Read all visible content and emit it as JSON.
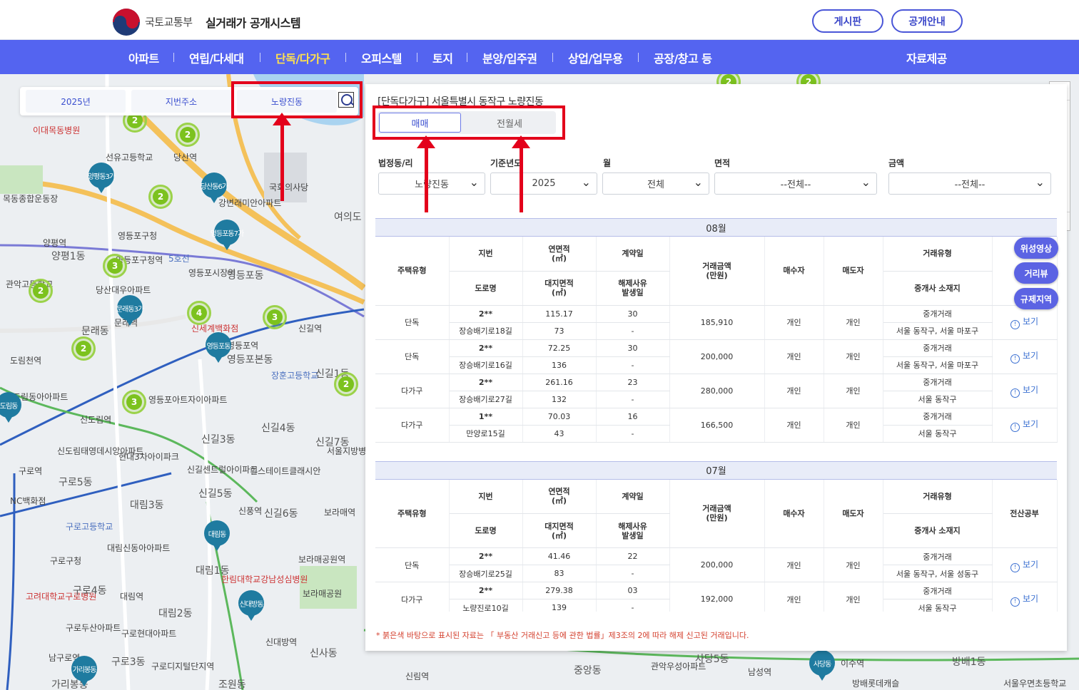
{
  "header": {
    "ministry": "국토교통부",
    "system_title": "실거래가 공개시스템",
    "board_label": "게시판",
    "info_label": "공개안내"
  },
  "nav": {
    "items": [
      {
        "label": "아파트",
        "active": false
      },
      {
        "label": "연립/다세대",
        "active": false
      },
      {
        "label": "단독/다가구",
        "active": true
      },
      {
        "label": "오피스텔",
        "active": false
      },
      {
        "label": "토지",
        "active": false
      },
      {
        "label": "분양/입주권",
        "active": false
      },
      {
        "label": "상업/업무용",
        "active": false
      },
      {
        "label": "공장/창고 등",
        "active": false
      }
    ],
    "data_label": "자료제공"
  },
  "search": {
    "year": "2025년",
    "address_type": "지번주소",
    "dong": "노량진동"
  },
  "panel": {
    "title": "[단독다가구] 서울특별시 동작구 노량진동",
    "tabs": [
      "매매",
      "전월세"
    ],
    "filters": {
      "labels": [
        "법정동/리",
        "기준년도",
        "월",
        "면적",
        "금액"
      ],
      "values": [
        "노량진동",
        "2025",
        "전체",
        "--전체--",
        "--전체--"
      ]
    },
    "headers": {
      "house_type": "주택유형",
      "jibun": "지번",
      "road": "도로명",
      "area": "연면적\n(㎡)",
      "land_area": "대지면적\n(㎡)",
      "contract_day": "계약일",
      "cancel": "해제사유\n발생일",
      "price": "거래금액\n(만원)",
      "buyer": "매수자",
      "seller": "매도자",
      "deal_type": "거래유형",
      "agent_loc": "중개사 소재지",
      "registry": "전산공부"
    },
    "months": [
      {
        "label": "08월",
        "rows": [
          {
            "type": "단독",
            "jibun": "2**",
            "road": "장승배기로18길",
            "area": "115.17",
            "land": "73",
            "day": "30",
            "cancel": "-",
            "price": "185,910",
            "buyer": "개인",
            "seller": "개인",
            "deal": "중개거래",
            "agent": "서울 동작구, 서울 마포구",
            "view": "보기"
          },
          {
            "type": "단독",
            "jibun": "2**",
            "road": "장승배기로16길",
            "area": "72.25",
            "land": "136",
            "day": "30",
            "cancel": "-",
            "price": "200,000",
            "buyer": "개인",
            "seller": "개인",
            "deal": "중개거래",
            "agent": "서울 동작구, 서울 마포구",
            "view": "보기"
          },
          {
            "type": "다가구",
            "jibun": "2**",
            "road": "장승배기로27길",
            "area": "261.16",
            "land": "132",
            "day": "23",
            "cancel": "-",
            "price": "280,000",
            "buyer": "개인",
            "seller": "개인",
            "deal": "중개거래",
            "agent": "서울 동작구",
            "view": "보기"
          },
          {
            "type": "다가구",
            "jibun": "1**",
            "road": "만양로15길",
            "area": "70.03",
            "land": "43",
            "day": "16",
            "cancel": "-",
            "price": "166,500",
            "buyer": "개인",
            "seller": "개인",
            "deal": "중개거래",
            "agent": "서울 동작구",
            "view": "보기"
          }
        ]
      },
      {
        "label": "07월",
        "rows": [
          {
            "type": "단독",
            "jibun": "2**",
            "road": "장승배기로25길",
            "area": "41.46",
            "land": "83",
            "day": "22",
            "cancel": "-",
            "price": "200,000",
            "buyer": "개인",
            "seller": "개인",
            "deal": "중개거래",
            "agent": "서울 동작구, 서울 성동구",
            "view": "보기"
          },
          {
            "type": "다가구",
            "jibun": "2**",
            "road": "노량진로10길",
            "area": "279.38",
            "land": "139",
            "day": "03",
            "cancel": "-",
            "price": "192,000",
            "buyer": "개인",
            "seller": "개인",
            "deal": "중개거래",
            "agent": "서울 동작구",
            "view": "보기"
          }
        ]
      }
    ],
    "note": "* 붉은색 바탕으로 표시된 자료는 「 부동산 거래신고 등에 관한 법률」제3조의 2에 따라 해제 신고된 거래입니다."
  },
  "side_buttons": [
    "위성영상",
    "거리뷰",
    "규제지역"
  ],
  "map": {
    "labels": [
      "이대목동병원",
      "선유고등학교",
      "당산역",
      "목동종합운동장",
      "강변래미안아파트",
      "국회의사당",
      "여의도",
      "양평역",
      "양평1동",
      "영등포구청",
      "영등포구청역",
      "5호선",
      "관악고등학교",
      "당산대우아파트",
      "영등포시장역",
      "영등포동",
      "문래동",
      "문래역",
      "신세계백화점",
      "영등포역",
      "영등포본동",
      "신길역",
      "장훈고등학교",
      "신길1동",
      "도림천역",
      "도림동아아파트",
      "영등포아트자이아파트",
      "신도림역",
      "신도림태영데시앙아파트",
      "현대3차아이파크",
      "신길3동",
      "신길4동",
      "신길7동",
      "서울지방병무청",
      "구로역",
      "구로5동",
      "신길센트럴아이파크",
      "힐스테이트클래시안",
      "신길5동",
      "NC백화점",
      "대림3동",
      "신풍역",
      "신길6동",
      "보라매역",
      "구로고등학교",
      "대림신동아아파트",
      "구로구청",
      "보라매공원역",
      "대림1동",
      "한림대학교강남성심병원",
      "고려대학교구로병원",
      "구로4동",
      "대림역",
      "보라매공원",
      "대림2동",
      "신대방역",
      "구로두산아파트",
      "구로현대아파트",
      "신사동",
      "남구로역",
      "구로3동",
      "구로디지털단지역",
      "신림역",
      "중앙동",
      "관악우성아파트",
      "사당5동",
      "남성역",
      "이수역",
      "방배1동",
      "방배롯데캐슬",
      "서울우면초등학교",
      "가리봉동",
      "조원동"
    ],
    "clusters": [
      "2",
      "2",
      "2",
      "3",
      "2",
      "4",
      "3",
      "2",
      "2",
      "3",
      "2",
      "2"
    ],
    "pins": [
      "양평동3가",
      "당산동6가",
      "영등포동7가",
      "문래동3가",
      "영등포동",
      "도림동",
      "대림동",
      "신대방동",
      "가리봉동",
      "사당동"
    ]
  }
}
